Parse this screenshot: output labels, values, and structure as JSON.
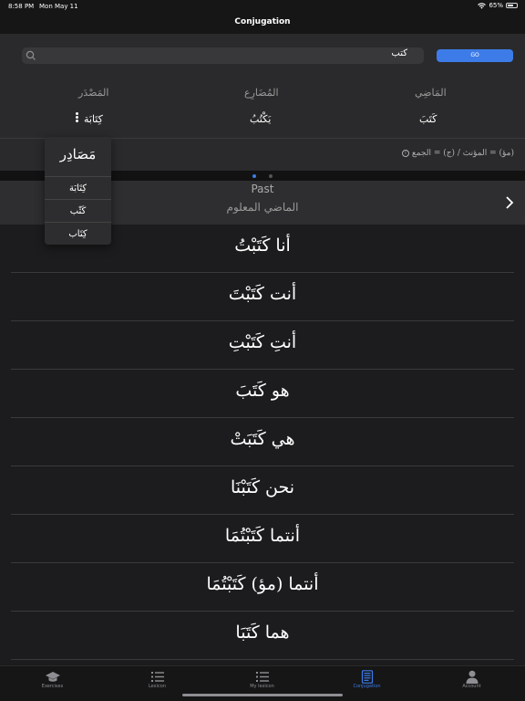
{
  "status_bar": {
    "time": "8:58 PM",
    "date": "Mon May 11",
    "battery": "65%"
  },
  "nav": {
    "title": "Conjugation"
  },
  "search": {
    "value": "كتب",
    "go_label": "GO"
  },
  "forms": {
    "past_header": "المَاضِي",
    "present_header": "المُضَارِع",
    "masdar_header": "المَصْدَر",
    "past_value": "كَتَبَ",
    "present_value": "يَكْتُبُ",
    "masdar_value": "كِتَابَة",
    "legend": "(مؤ) = المؤنث / (ج) = الجمع"
  },
  "dropdown": {
    "title": "مَصَادِر",
    "items": [
      "كِتَابَة",
      "كَتْب",
      "كِتَاب"
    ]
  },
  "tense": {
    "title": "Past",
    "subtitle": "الماضي المعلوم"
  },
  "conjugations": [
    "أنا كَتَبْتُ",
    "أنت كَتَبْتَ",
    "أنتِ كَتَبْتِ",
    "هو كَتَبَ",
    "هي كَتَبَتْ",
    "نحن كَتَبْنَا",
    "أنتما كَتَبْتُمَا",
    "أنتما (مؤ) كَتَبْتُمَا",
    "هما كَتَبَا"
  ],
  "tabs": [
    {
      "label": "Exercises",
      "icon": "graduation-cap-icon"
    },
    {
      "label": "Lexicon",
      "icon": "list-icon"
    },
    {
      "label": "My lexicon",
      "icon": "list-icon"
    },
    {
      "label": "Conjugation",
      "icon": "document-icon",
      "active": true
    },
    {
      "label": "Account",
      "icon": "person-icon"
    }
  ],
  "colors": {
    "accent": "#3d7ce8",
    "background": "#1c1c1e",
    "panel": "#2a2a2c"
  }
}
